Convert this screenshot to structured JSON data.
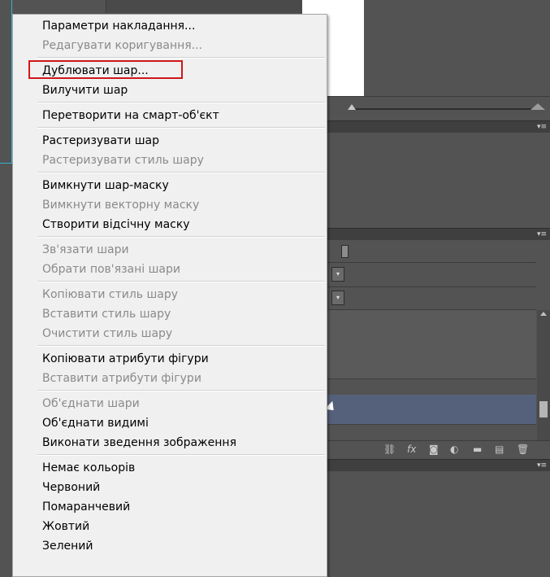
{
  "colors": {
    "workspace": "#535353",
    "menu_bg": "#f0f0f0",
    "menu_text": "#000000",
    "menu_disabled_text": "#8a8a8a",
    "highlight_border": "#d01818",
    "selected_layer": "#55617a",
    "guide": "#36b0d8"
  },
  "icons": {
    "panel_menu": "panel-menu-icon",
    "link_layers": "link-icon",
    "fx": "fx-icon",
    "mask": "mask-icon",
    "adjustment": "adjustment-icon",
    "group": "folder-icon",
    "new_layer": "new-layer-icon",
    "delete": "trash-icon"
  },
  "context_menu": {
    "items": [
      {
        "label": "Параметри накладання...",
        "enabled": true
      },
      {
        "label": "Редагувати коригування...",
        "enabled": false
      },
      {
        "label": "Дублювати шар...",
        "enabled": true,
        "highlighted": true
      },
      {
        "label": "Вилучити шар",
        "enabled": true
      },
      {
        "label": "Перетворити на смарт-об'єкт",
        "enabled": true
      },
      {
        "label": "Растеризувати шар",
        "enabled": true
      },
      {
        "label": "Растеризувати стиль шару",
        "enabled": false
      },
      {
        "label": "Вимкнути шар-маску",
        "enabled": true
      },
      {
        "label": "Вимкнути векторну маску",
        "enabled": false
      },
      {
        "label": "Створити відсічну маску",
        "enabled": true
      },
      {
        "label": "Зв'язати шари",
        "enabled": false
      },
      {
        "label": "Обрати пов'язані шари",
        "enabled": false
      },
      {
        "label": "Копіювати стиль шару",
        "enabled": false
      },
      {
        "label": "Вставити стиль шару",
        "enabled": false
      },
      {
        "label": "Очистити стиль шару",
        "enabled": false
      },
      {
        "label": "Копіювати атрибути фігури",
        "enabled": true
      },
      {
        "label": "Вставити атрибути фігури",
        "enabled": false
      },
      {
        "label": "Об'єднати шари",
        "enabled": false
      },
      {
        "label": "Об'єднати видимі",
        "enabled": true
      },
      {
        "label": "Виконати зведення зображення",
        "enabled": true
      },
      {
        "label": "Немає кольорів",
        "enabled": true
      },
      {
        "label": "Червоний",
        "enabled": true
      },
      {
        "label": "Помаранчевий",
        "enabled": true
      },
      {
        "label": "Жовтий",
        "enabled": true
      },
      {
        "label": "Зелений",
        "enabled": true
      }
    ]
  },
  "layers_toolbar": {
    "fx_label": "fx"
  }
}
